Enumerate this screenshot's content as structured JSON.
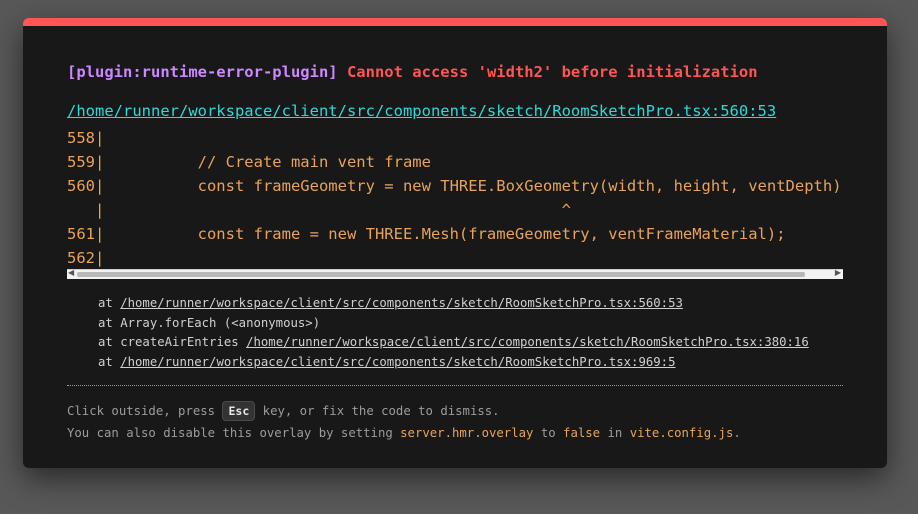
{
  "colors": {
    "accent_red": "#ff5555",
    "plugin_purple": "#cc88ff",
    "link_cyan": "#2dd9da",
    "code_orange": "#e8a35a",
    "background": "#181818",
    "backdrop": "#585858"
  },
  "error": {
    "plugin": "[plugin:runtime-error-plugin]",
    "message": "Cannot access 'width2' before initialization"
  },
  "file_link": "/home/runner/workspace/client/src/components/sketch/RoomSketchPro.tsx:560:53",
  "code_frame": [
    "558|",
    "559|          // Create main vent frame",
    "560|          const frameGeometry = new THREE.BoxGeometry(width, height, ventDepth);",
    "   |                                                 ^",
    "561|          const frame = new THREE.Mesh(frameGeometry, ventFrameMaterial);",
    "562|"
  ],
  "stack": [
    {
      "prefix": "at ",
      "location": "/home/runner/workspace/client/src/components/sketch/RoomSketchPro.tsx:560:53"
    },
    {
      "prefix": "at Array.forEach (<anonymous>)",
      "location": ""
    },
    {
      "prefix": "at createAirEntries ",
      "location": "/home/runner/workspace/client/src/components/sketch/RoomSketchPro.tsx:380:16"
    },
    {
      "prefix": "at ",
      "location": "/home/runner/workspace/client/src/components/sketch/RoomSketchPro.tsx:969:5"
    }
  ],
  "tip": {
    "line1_before": "Click outside, press ",
    "key": "Esc",
    "line1_after": " key, or fix the code to dismiss.",
    "line2_a": "You can also disable this overlay by setting ",
    "line2_setting": "server.hmr.overlay",
    "line2_b": " to ",
    "line2_value": "false",
    "line2_c": " in ",
    "line2_file": "vite.config.js",
    "line2_d": "."
  },
  "scrollbar": {
    "left_arrow_icon": "scroll-left-arrow",
    "right_arrow_icon": "scroll-right-arrow"
  }
}
